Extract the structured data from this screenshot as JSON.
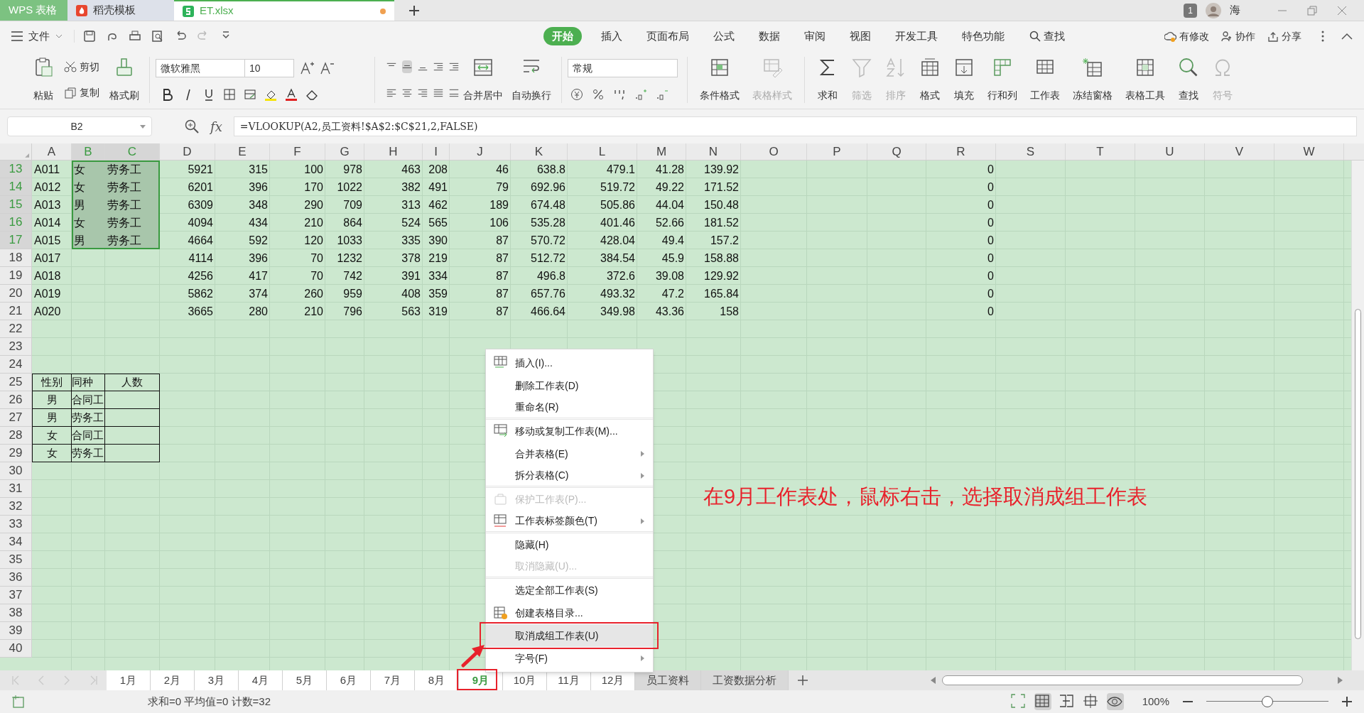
{
  "title_tabs": [
    {
      "label": "WPS 表格",
      "kind": "app",
      "selected": false
    },
    {
      "label": "稻壳模板",
      "kind": "docer",
      "selected": false
    },
    {
      "label": "ET.xlsx",
      "kind": "file",
      "selected": true,
      "unsaved": true
    }
  ],
  "title_right": {
    "badge": "1",
    "user": "海"
  },
  "menu": {
    "file": "文件",
    "tabs": [
      {
        "label": "开始",
        "selected": true
      },
      {
        "label": "插入",
        "selected": false
      },
      {
        "label": "页面布局",
        "selected": false
      },
      {
        "label": "公式",
        "selected": false
      },
      {
        "label": "数据",
        "selected": false
      },
      {
        "label": "审阅",
        "selected": false
      },
      {
        "label": "视图",
        "selected": false
      },
      {
        "label": "开发工具",
        "selected": false
      },
      {
        "label": "特色功能",
        "selected": false
      }
    ],
    "search": "查找",
    "actions": [
      "有修改",
      "协作",
      "分享"
    ]
  },
  "ribbon": {
    "paste": "粘贴",
    "cut": "剪切",
    "copy": "复制",
    "format_painter": "格式刷",
    "font_name": "微软雅黑",
    "font_size": "10",
    "merge": "合并居中",
    "wrap": "自动换行",
    "number_format": "常规",
    "large_buttons": [
      {
        "label": "条件格式",
        "disabled": false
      },
      {
        "label": "表格样式",
        "disabled": true
      },
      {
        "label": "求和",
        "disabled": false
      },
      {
        "label": "筛选",
        "disabled": true
      },
      {
        "label": "排序",
        "disabled": true
      },
      {
        "label": "格式",
        "disabled": false
      },
      {
        "label": "填充",
        "disabled": false
      },
      {
        "label": "行和列",
        "disabled": false
      },
      {
        "label": "工作表",
        "disabled": false
      },
      {
        "label": "冻结窗格",
        "disabled": false
      },
      {
        "label": "表格工具",
        "disabled": false
      },
      {
        "label": "查找",
        "disabled": false
      },
      {
        "label": "符号",
        "disabled": true
      }
    ]
  },
  "formula_bar": {
    "name_box": "B2",
    "function_label": "fx",
    "formula": "=VLOOKUP(A2,员工资料!$A$2:$C$21,2,FALSE)"
  },
  "columns": [
    {
      "letter": "A",
      "selected": false
    },
    {
      "letter": "B",
      "selected": true
    },
    {
      "letter": "C",
      "selected": true
    },
    {
      "letter": "D",
      "selected": false
    },
    {
      "letter": "E",
      "selected": false
    },
    {
      "letter": "F",
      "selected": false
    },
    {
      "letter": "G",
      "selected": false
    },
    {
      "letter": "H",
      "selected": false
    },
    {
      "letter": "I",
      "selected": false
    },
    {
      "letter": "J",
      "selected": false
    },
    {
      "letter": "K",
      "selected": false
    },
    {
      "letter": "L",
      "selected": false
    },
    {
      "letter": "M",
      "selected": false
    },
    {
      "letter": "N",
      "selected": false
    },
    {
      "letter": "O",
      "selected": false
    },
    {
      "letter": "P",
      "selected": false
    },
    {
      "letter": "Q",
      "selected": false
    },
    {
      "letter": "R",
      "selected": false
    },
    {
      "letter": "S",
      "selected": false
    },
    {
      "letter": "T",
      "selected": false
    },
    {
      "letter": "U",
      "selected": false
    },
    {
      "letter": "V",
      "selected": false
    },
    {
      "letter": "W",
      "selected": false
    }
  ],
  "rows": [
    {
      "number": "13",
      "selected": true,
      "kind": "data",
      "cells": [
        "A011",
        "女",
        "劳务工",
        "5921",
        "315",
        "100",
        "978",
        "463",
        "208",
        "46",
        "638.8",
        "479.1",
        "41.28",
        "139.92",
        null,
        null,
        null,
        "0"
      ]
    },
    {
      "number": "14",
      "selected": true,
      "kind": "data",
      "cells": [
        "A012",
        "女",
        "劳务工",
        "6201",
        "396",
        "170",
        "1022",
        "382",
        "491",
        "79",
        "692.96",
        "519.72",
        "49.22",
        "171.52",
        null,
        null,
        null,
        "0"
      ]
    },
    {
      "number": "15",
      "selected": true,
      "kind": "data",
      "cells": [
        "A013",
        "男",
        "劳务工",
        "6309",
        "348",
        "290",
        "709",
        "313",
        "462",
        "189",
        "674.48",
        "505.86",
        "44.04",
        "150.48",
        null,
        null,
        null,
        "0"
      ]
    },
    {
      "number": "16",
      "selected": true,
      "kind": "data",
      "cells": [
        "A014",
        "女",
        "劳务工",
        "4094",
        "434",
        "210",
        "864",
        "524",
        "565",
        "106",
        "535.28",
        "401.46",
        "52.66",
        "181.52",
        null,
        null,
        null,
        "0"
      ]
    },
    {
      "number": "17",
      "selected": true,
      "kind": "data",
      "cells": [
        "A015",
        "男",
        "劳务工",
        "4664",
        "592",
        "120",
        "1033",
        "335",
        "390",
        "87",
        "570.72",
        "428.04",
        "49.4",
        "157.2",
        null,
        null,
        null,
        "0"
      ]
    },
    {
      "number": "18",
      "selected": false,
      "kind": "data",
      "cells": [
        "A017",
        null,
        null,
        "4114",
        "396",
        "70",
        "1232",
        "378",
        "219",
        "87",
        "512.72",
        "384.54",
        "45.9",
        "158.88",
        null,
        null,
        null,
        "0"
      ]
    },
    {
      "number": "19",
      "selected": false,
      "kind": "data",
      "cells": [
        "A018",
        null,
        null,
        "4256",
        "417",
        "70",
        "742",
        "391",
        "334",
        "87",
        "496.8",
        "372.6",
        "39.08",
        "129.92",
        null,
        null,
        null,
        "0"
      ]
    },
    {
      "number": "20",
      "selected": false,
      "kind": "data",
      "cells": [
        "A019",
        null,
        null,
        "5862",
        "374",
        "260",
        "959",
        "408",
        "359",
        "87",
        "657.76",
        "493.32",
        "47.2",
        "165.84",
        null,
        null,
        null,
        "0"
      ]
    },
    {
      "number": "21",
      "selected": false,
      "kind": "data",
      "cells": [
        "A020",
        null,
        null,
        "3665",
        "280",
        "210",
        "796",
        "563",
        "319",
        "87",
        "466.64",
        "349.98",
        "43.36",
        "158",
        null,
        null,
        null,
        "0"
      ]
    },
    {
      "number": "22",
      "selected": false,
      "kind": "data"
    },
    {
      "number": "23",
      "selected": false,
      "kind": "data"
    },
    {
      "number": "24",
      "selected": false,
      "kind": "data"
    },
    {
      "number": "25",
      "selected": false,
      "kind": "table",
      "cells": [
        "性别",
        "同种",
        "人数"
      ]
    },
    {
      "number": "26",
      "selected": false,
      "kind": "table",
      "cells": [
        "男",
        "合同工",
        null
      ]
    },
    {
      "number": "27",
      "selected": false,
      "kind": "table",
      "cells": [
        "男",
        "劳务工",
        null
      ]
    },
    {
      "number": "28",
      "selected": false,
      "kind": "table",
      "cells": [
        "女",
        "合同工",
        null
      ]
    },
    {
      "number": "29",
      "selected": false,
      "kind": "table",
      "cells": [
        "女",
        "劳务工",
        null
      ]
    },
    {
      "number": "30",
      "selected": false,
      "kind": "data"
    },
    {
      "number": "31",
      "selected": false,
      "kind": "data"
    },
    {
      "number": "32",
      "selected": false,
      "kind": "data"
    },
    {
      "number": "33",
      "selected": false,
      "kind": "data"
    },
    {
      "number": "34",
      "selected": false,
      "kind": "data"
    },
    {
      "number": "35",
      "selected": false,
      "kind": "data"
    },
    {
      "number": "36",
      "selected": false,
      "kind": "data"
    },
    {
      "number": "37",
      "selected": false,
      "kind": "data"
    },
    {
      "number": "38",
      "selected": false,
      "kind": "data"
    },
    {
      "number": "39",
      "selected": false,
      "kind": "data"
    },
    {
      "number": "40",
      "selected": false,
      "kind": "data"
    }
  ],
  "sheet_tabs": [
    {
      "label": "1月",
      "selected": false,
      "grouped": true
    },
    {
      "label": "2月",
      "selected": false,
      "grouped": true
    },
    {
      "label": "3月",
      "selected": false,
      "grouped": true
    },
    {
      "label": "4月",
      "selected": false,
      "grouped": true
    },
    {
      "label": "5月",
      "selected": false,
      "grouped": true
    },
    {
      "label": "6月",
      "selected": false,
      "grouped": true
    },
    {
      "label": "7月",
      "selected": false,
      "grouped": true
    },
    {
      "label": "8月",
      "selected": false,
      "grouped": true
    },
    {
      "label": "9月",
      "selected": true,
      "grouped": true
    },
    {
      "label": "10月",
      "selected": false,
      "grouped": true
    },
    {
      "label": "11月",
      "selected": false,
      "grouped": true
    },
    {
      "label": "12月",
      "selected": false,
      "grouped": true
    },
    {
      "label": "员工资料",
      "selected": false,
      "grouped": false
    },
    {
      "label": "工资数据分析",
      "selected": false,
      "grouped": false
    }
  ],
  "context_menu": [
    {
      "label": "插入(I)...",
      "disabled": false,
      "submenu": false,
      "highlighted": false,
      "divider_after": false
    },
    {
      "label": "删除工作表(D)",
      "disabled": false,
      "submenu": false,
      "highlighted": false,
      "divider_after": false
    },
    {
      "label": "重命名(R)",
      "disabled": false,
      "submenu": false,
      "highlighted": false,
      "divider_after": true
    },
    {
      "label": "移动或复制工作表(M)...",
      "disabled": false,
      "submenu": false,
      "highlighted": false,
      "divider_after": false
    },
    {
      "label": "合并表格(E)",
      "disabled": false,
      "submenu": true,
      "highlighted": false,
      "divider_after": false
    },
    {
      "label": "拆分表格(C)",
      "disabled": false,
      "submenu": true,
      "highlighted": false,
      "divider_after": true
    },
    {
      "label": "保护工作表(P)...",
      "disabled": true,
      "submenu": false,
      "highlighted": false,
      "divider_after": false
    },
    {
      "label": "工作表标签颜色(T)",
      "disabled": false,
      "submenu": true,
      "highlighted": false,
      "divider_after": true
    },
    {
      "label": "隐藏(H)",
      "disabled": false,
      "submenu": false,
      "highlighted": false,
      "divider_after": false
    },
    {
      "label": "取消隐藏(U)...",
      "disabled": true,
      "submenu": false,
      "highlighted": false,
      "divider_after": true
    },
    {
      "label": "选定全部工作表(S)",
      "disabled": false,
      "submenu": false,
      "highlighted": false,
      "divider_after": false
    },
    {
      "label": "创建表格目录...",
      "disabled": false,
      "submenu": false,
      "highlighted": false,
      "divider_after": false
    },
    {
      "label": "取消成组工作表(U)",
      "disabled": false,
      "submenu": false,
      "highlighted": true,
      "divider_after": false
    },
    {
      "label": "字号(F)",
      "disabled": false,
      "submenu": true,
      "highlighted": false,
      "divider_after": false
    }
  ],
  "annotation": "在9月工作表处，鼠标右击，选择取消成组工作表",
  "status_bar": {
    "summary": "求和=0 平均值=0 计数=32",
    "zoom": "100%",
    "zoom_slider": {
      "level": 0.5
    }
  }
}
